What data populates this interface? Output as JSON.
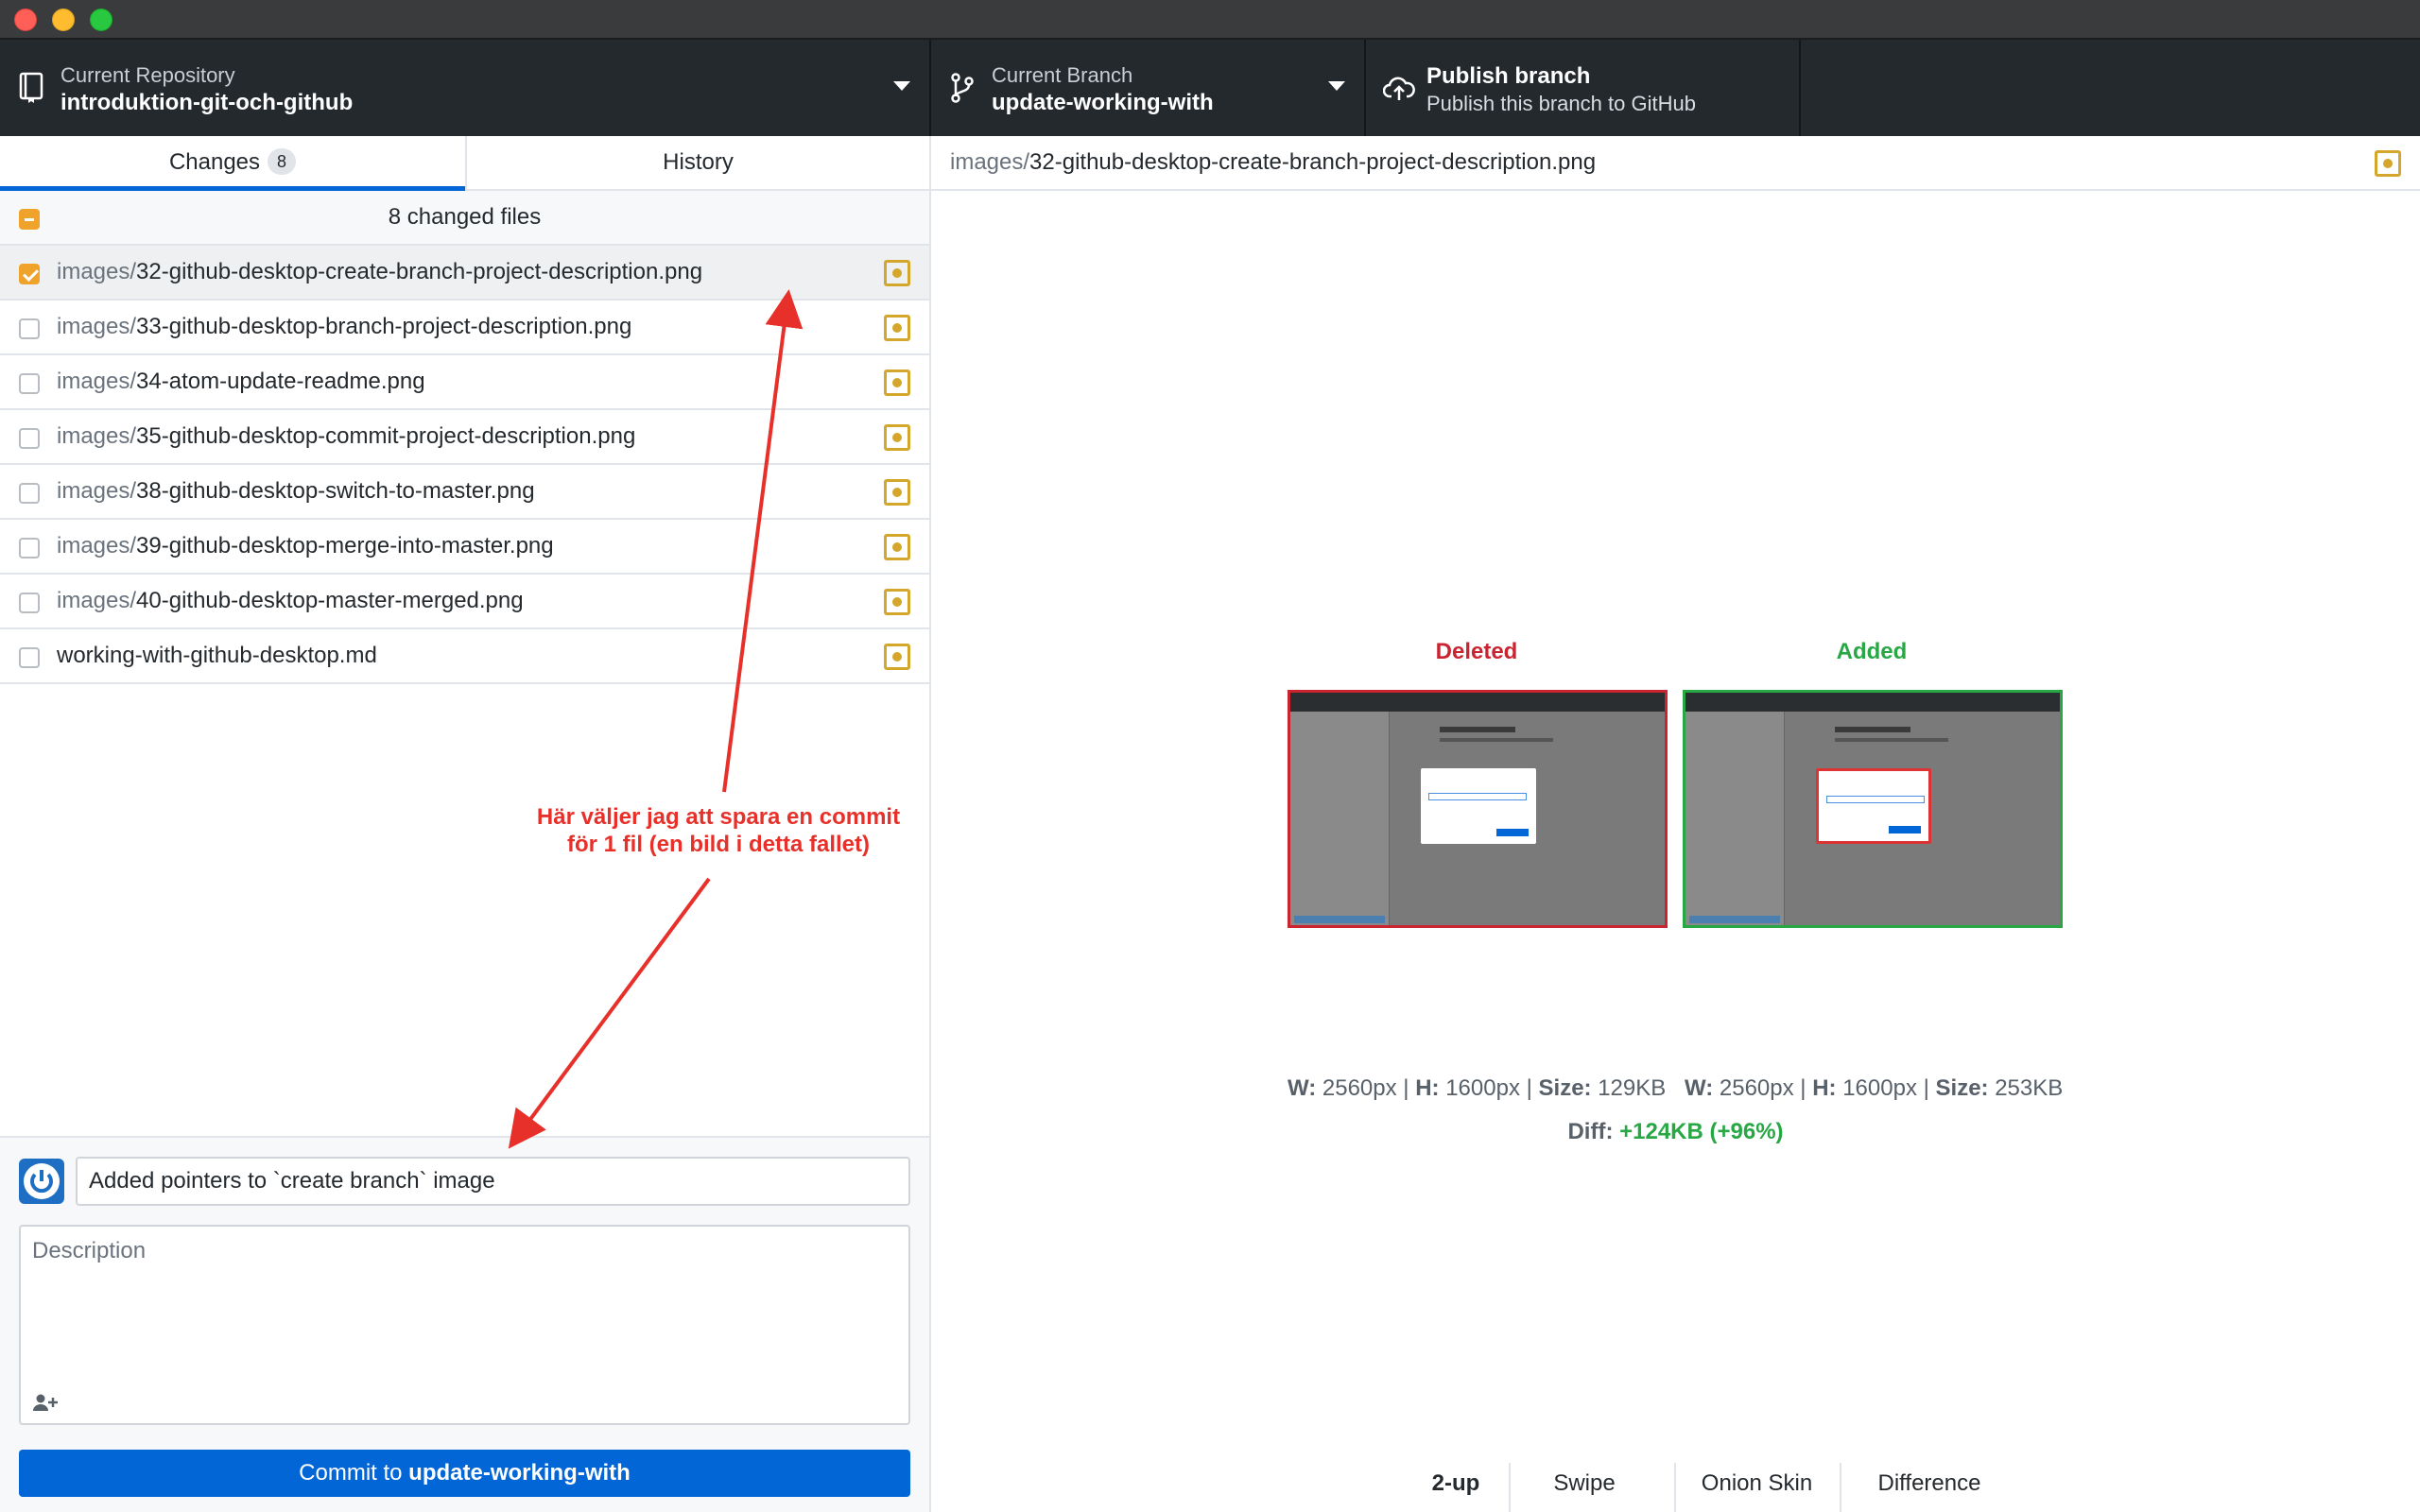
{
  "toolbar": {
    "repo_label": "Current Repository",
    "repo_name": "introduktion-git-och-github",
    "branch_label": "Current Branch",
    "branch_name": "update-working-with",
    "publish_title": "Publish branch",
    "publish_sub": "Publish this branch to GitHub"
  },
  "tabs": {
    "changes_label": "Changes",
    "changes_count": "8",
    "history_label": "History"
  },
  "changes": {
    "header": "8 changed files",
    "files": [
      {
        "dir": "images/",
        "name": "32-github-desktop-create-branch-project-description.png",
        "checked": true
      },
      {
        "dir": "images/",
        "name": "33-github-desktop-branch-project-description.png",
        "checked": false
      },
      {
        "dir": "images/",
        "name": "34-atom-update-readme.png",
        "checked": false
      },
      {
        "dir": "images/",
        "name": "35-github-desktop-commit-project-description.png",
        "checked": false
      },
      {
        "dir": "images/",
        "name": "38-github-desktop-switch-to-master.png",
        "checked": false
      },
      {
        "dir": "images/",
        "name": "39-github-desktop-merge-into-master.png",
        "checked": false
      },
      {
        "dir": "images/",
        "name": "40-github-desktop-master-merged.png",
        "checked": false
      },
      {
        "dir": "",
        "name": "working-with-github-desktop.md",
        "checked": false
      }
    ]
  },
  "commit": {
    "summary": "Added pointers to `create branch` image",
    "description_placeholder": "Description",
    "button_prefix": "Commit to ",
    "button_branch": "update-working-with"
  },
  "diff": {
    "path_dir": "images/",
    "path_name": "32-github-desktop-create-branch-project-description.png",
    "deleted_label": "Deleted",
    "added_label": "Added",
    "deleted_meta": {
      "w_label": "W:",
      "w": " 2560px | ",
      "h_label": "H:",
      "h": " 1600px | ",
      "size_label": "Size:",
      "size": " 129KB"
    },
    "added_meta": {
      "w_label": "W:",
      "w": " 2560px | ",
      "h_label": "H:",
      "h": " 1600px | ",
      "size_label": "Size:",
      "size": " 253KB"
    },
    "diff_label": "Diff: ",
    "diff_value": "+124KB (+96%)",
    "modes": [
      "2-up",
      "Swipe",
      "Onion Skin",
      "Difference"
    ],
    "active_mode": "2-up"
  },
  "annotation": {
    "line1": "Här väljer jag att spara en commit",
    "line2": "för 1 fil (en bild i detta fallet)",
    "color": "#e8302a"
  },
  "colors": {
    "accent": "#0366d6",
    "modified": "#d4a72c",
    "deleted": "#cb2431",
    "added": "#28a745"
  }
}
